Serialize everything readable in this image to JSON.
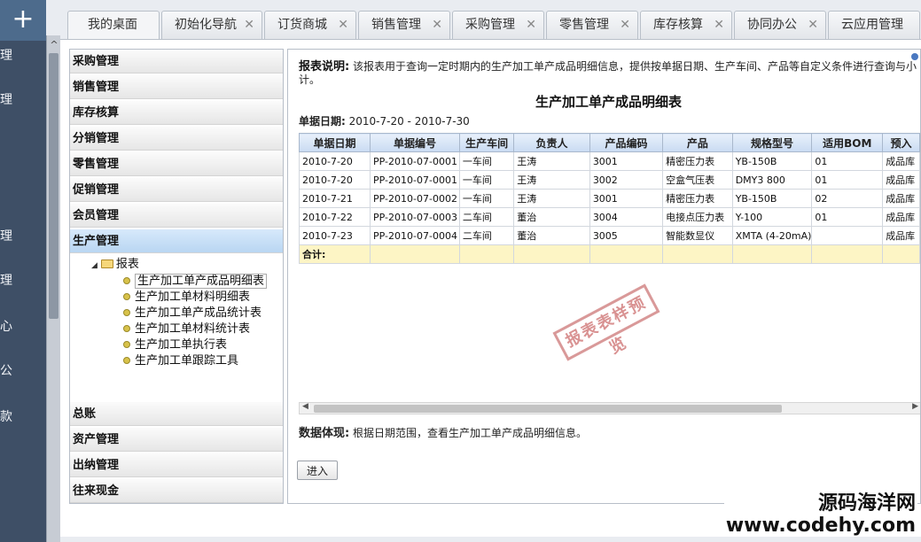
{
  "rail": {
    "plus": "+",
    "items": [
      "理",
      "理",
      "理",
      "理",
      "心",
      "公",
      "款"
    ]
  },
  "tabs": [
    {
      "label": "我的桌面",
      "closable": false
    },
    {
      "label": "初始化导航",
      "closable": true
    },
    {
      "label": "订货商城",
      "closable": true
    },
    {
      "label": "销售管理",
      "closable": true
    },
    {
      "label": "采购管理",
      "closable": true
    },
    {
      "label": "零售管理",
      "closable": true
    },
    {
      "label": "库存核算",
      "closable": true
    },
    {
      "label": "协同办公",
      "closable": true
    },
    {
      "label": "云应用管理",
      "closable": true
    }
  ],
  "menu": {
    "sections_top": [
      "采购管理",
      "销售管理",
      "库存核算",
      "分销管理",
      "零售管理",
      "促销管理",
      "会员管理",
      "生产管理"
    ],
    "active": "生产管理",
    "tree": {
      "folder": "报表",
      "items": [
        "生产加工单产成品明细表",
        "生产加工单材料明细表",
        "生产加工单产成品统计表",
        "生产加工单材料统计表",
        "生产加工单执行表",
        "生产加工单跟踪工具"
      ]
    },
    "sections_bottom": [
      "总账",
      "资产管理",
      "出纳管理",
      "往来现金"
    ]
  },
  "report": {
    "desc_label": "报表说明:",
    "desc_text": "该报表用于查询一定时期内的生产加工单产成品明细信息，提供按单据日期、生产车间、产品等自定义条件进行查询与小计。",
    "title": "生产加工单产成品明细表",
    "date_label": "单据日期:",
    "date_value": "2010-7-20 - 2010-7-30",
    "columns": [
      "单据日期",
      "单据编号",
      "生产车间",
      "负责人",
      "产品编码",
      "产品",
      "规格型号",
      "适用BOM",
      "预入"
    ],
    "rows": [
      [
        "2010-7-20",
        "PP-2010-07-0001",
        "一车间",
        "王涛",
        "3001",
        "精密压力表",
        "YB-150B",
        "01",
        "成品库"
      ],
      [
        "2010-7-20",
        "PP-2010-07-0001",
        "一车间",
        "王涛",
        "3002",
        "空盒气压表",
        "DMY3 800",
        "01",
        "成品库"
      ],
      [
        "2010-7-21",
        "PP-2010-07-0002",
        "一车间",
        "王涛",
        "3001",
        "精密压力表",
        "YB-150B",
        "02",
        "成品库"
      ],
      [
        "2010-7-22",
        "PP-2010-07-0003",
        "二车间",
        "董治",
        "3004",
        "电接点压力表",
        "Y-100",
        "01",
        "成品库"
      ],
      [
        "2010-7-23",
        "PP-2010-07-0004",
        "二车间",
        "董治",
        "3005",
        "智能数显仪",
        "XMTA (4-20mA)",
        "",
        "成品库"
      ]
    ],
    "sum_label": "合计:",
    "stamp": "报表表样预览",
    "note_label": "数据体现:",
    "note_text": "根据日期范围，查看生产加工单产成品明细信息。",
    "enter_button": "进入"
  },
  "watermark": {
    "line1": "源码海洋网",
    "line2": "www.codehy.com"
  }
}
